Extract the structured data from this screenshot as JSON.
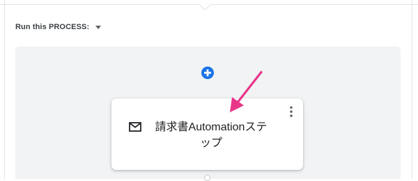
{
  "trigger": {
    "label": "Run this PROCESS:",
    "dropdown_icon": "caret-down-icon"
  },
  "canvas": {
    "add_step_icon": "add-circle-icon",
    "step": {
      "icon": "mail-icon",
      "title": "請求書Automationステップ",
      "menu_icon": "more-vert-icon"
    },
    "annotation_icon": "pink-arrow-icon"
  },
  "colors": {
    "accent": "#1a73e8",
    "annotation": "#e8358a",
    "canvas_bg": "#f1f3f4",
    "text": "#202124"
  }
}
